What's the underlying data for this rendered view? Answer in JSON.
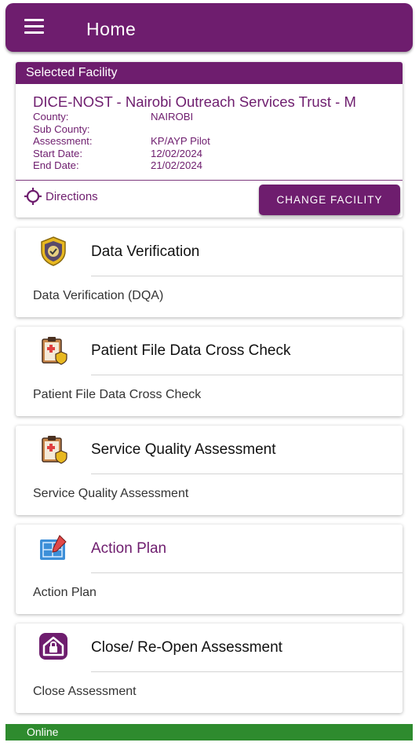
{
  "appbar": {
    "title": "Home",
    "menu_icon": "hamburger-menu-icon"
  },
  "facility": {
    "header": "Selected Facility",
    "name": "DICE-NOST - Nairobi Outreach Services Trust - M",
    "fields": [
      {
        "label": "County:",
        "value": "NAIROBI"
      },
      {
        "label": "Sub County:",
        "value": ""
      },
      {
        "label": "Assessment:",
        "value": "KP/AYP Pilot"
      },
      {
        "label": "Start Date:",
        "value": "12/02/2024"
      },
      {
        "label": "End Date:",
        "value": "21/02/2024"
      }
    ],
    "directions_label": "Directions",
    "change_button": "CHANGE FACILITY"
  },
  "menu": [
    {
      "title": "Data Verification",
      "subtitle": "Data Verification (DQA)",
      "icon": "shield-check-icon"
    },
    {
      "title": "Patient File Data Cross Check",
      "subtitle": "Patient File Data Cross Check",
      "icon": "clipboard-shield-icon"
    },
    {
      "title": "Service Quality Assessment",
      "subtitle": "Service Quality Assessment",
      "icon": "clipboard-shield-icon"
    },
    {
      "title": "Action Plan",
      "subtitle": "Action Plan",
      "icon": "blueprint-pencil-icon"
    },
    {
      "title": "Close/ Re-Open Assessment",
      "subtitle": "Close Assessment",
      "icon": "house-lock-icon"
    }
  ],
  "status": {
    "text": "Online",
    "color": "#2e8b2e"
  },
  "colors": {
    "primary": "#6e1d6e"
  }
}
